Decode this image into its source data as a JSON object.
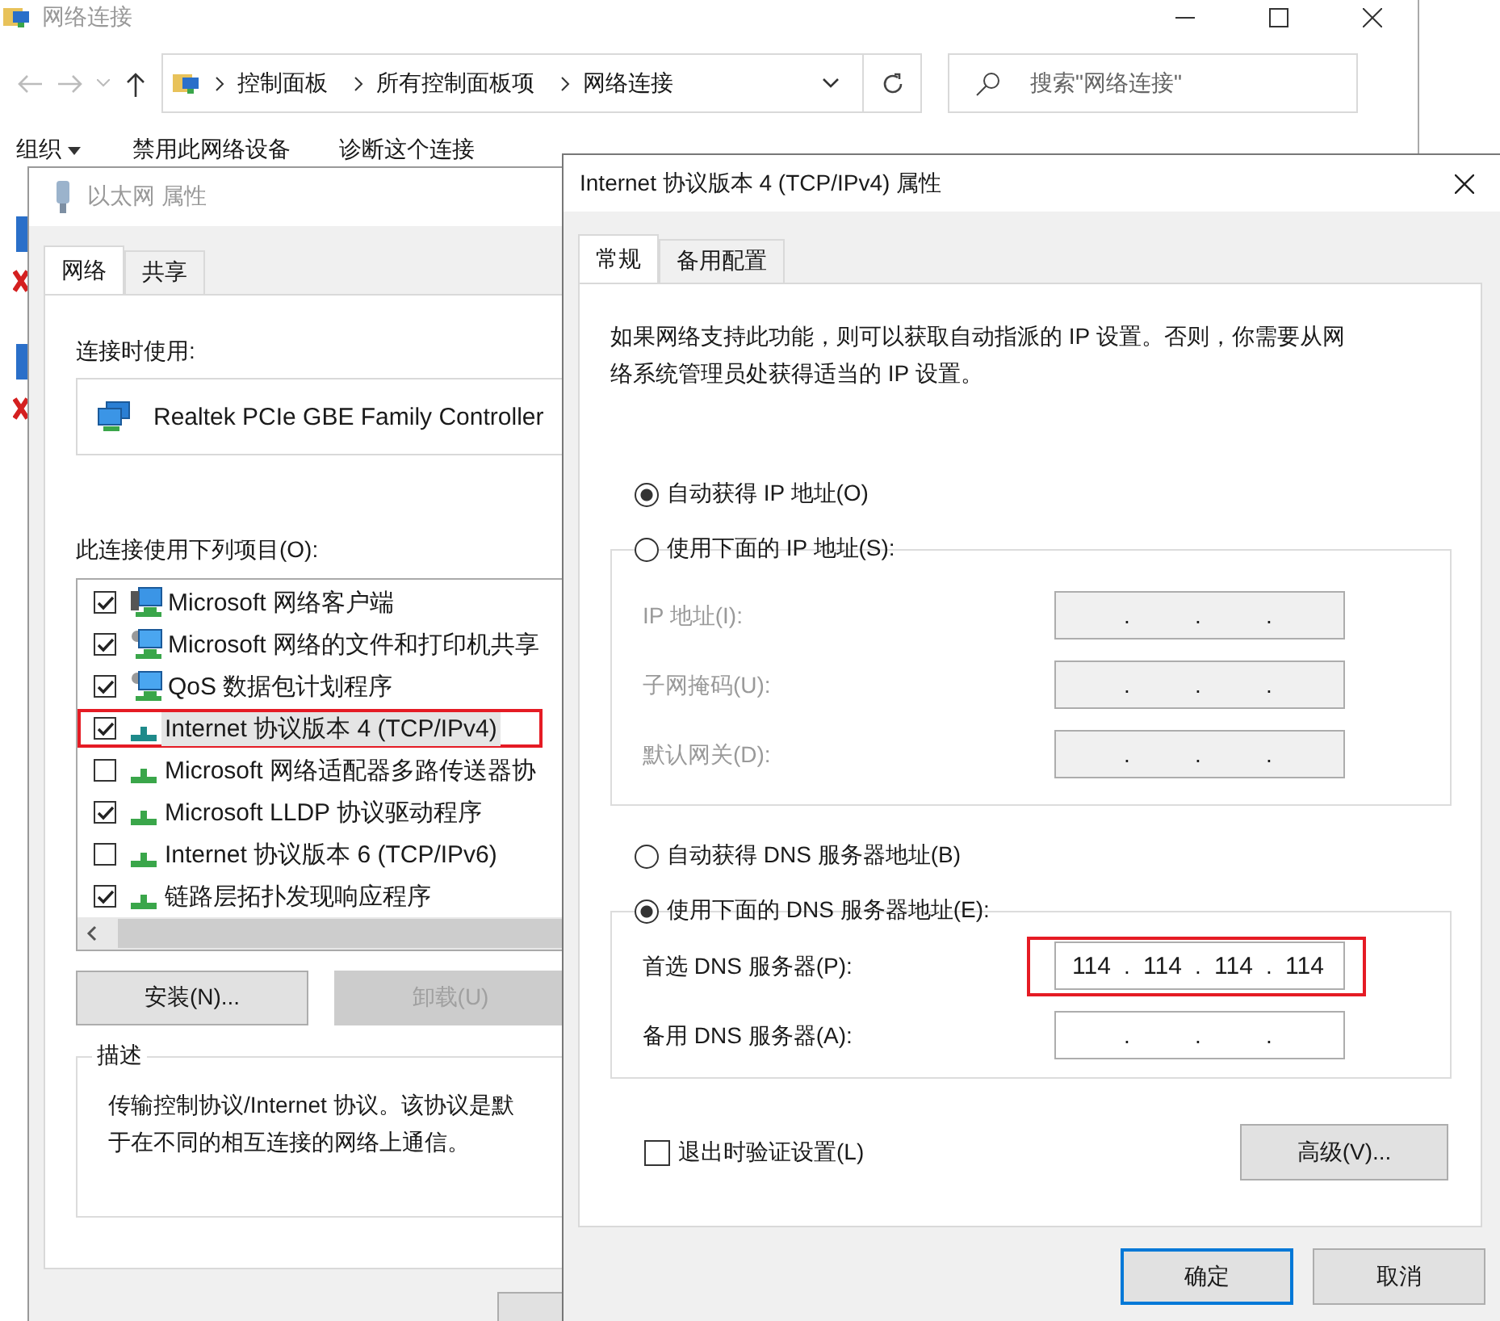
{
  "explorer": {
    "title": "网络连接",
    "breadcrumb": [
      "控制面板",
      "所有控制面板项",
      "网络连接"
    ],
    "search": {
      "placeholder": "搜索\"网络连接\""
    },
    "toolbar": [
      "组织",
      "禁用此网络设备",
      "诊断这个连接"
    ]
  },
  "ethernet_dialog": {
    "title": "以太网 属性",
    "tabs": [
      {
        "label": "网络",
        "selected": true
      },
      {
        "label": "共享",
        "selected": false
      }
    ],
    "connect_using_label": "连接时使用:",
    "adapter": "Realtek PCIe GBE Family Controller",
    "items_label": "此连接使用下列项目(O):",
    "items": [
      {
        "label": "Microsoft 网络客户端",
        "checked": true,
        "kind": "client",
        "selected": false,
        "annotated": false
      },
      {
        "label": "Microsoft 网络的文件和打印机共享",
        "checked": true,
        "kind": "service",
        "selected": false,
        "annotated": false
      },
      {
        "label": "QoS 数据包计划程序",
        "checked": true,
        "kind": "service",
        "selected": false,
        "annotated": false
      },
      {
        "label": "Internet 协议版本 4 (TCP/IPv4)",
        "checked": true,
        "kind": "protocol",
        "selected": true,
        "annotated": true
      },
      {
        "label": "Microsoft 网络适配器多路传送器协",
        "checked": false,
        "kind": "protocol",
        "selected": false,
        "annotated": false
      },
      {
        "label": "Microsoft LLDP 协议驱动程序",
        "checked": true,
        "kind": "protocol",
        "selected": false,
        "annotated": false
      },
      {
        "label": "Internet 协议版本 6 (TCP/IPv6)",
        "checked": false,
        "kind": "protocol",
        "selected": false,
        "annotated": false
      },
      {
        "label": "链路层拓扑发现响应程序",
        "checked": true,
        "kind": "protocol",
        "selected": false,
        "annotated": false
      }
    ],
    "buttons": [
      {
        "label": "安装(N)...",
        "disabled": false
      },
      {
        "label": "卸载(U)",
        "disabled": true
      }
    ],
    "description_label": "描述",
    "description_lines": [
      "传输控制协议/Internet 协议。该协议是默",
      "于在不同的相互连接的网络上通信。"
    ]
  },
  "ipv4_dialog": {
    "title": "Internet 协议版本 4 (TCP/IPv4) 属性",
    "tabs": [
      {
        "label": "常规",
        "selected": true
      },
      {
        "label": "备用配置",
        "selected": false
      }
    ],
    "intro": "如果网络支持此功能，则可以获取自动指派的 IP 设置。否则，你需要从网络系统管理员处获得适当的 IP 设置。",
    "ip_options": [
      {
        "label": "自动获得 IP 地址(O)",
        "selected": true
      },
      {
        "label": "使用下面的 IP 地址(S):",
        "selected": false
      }
    ],
    "ip_fields": [
      {
        "label": "IP 地址(I):",
        "disabled": true,
        "separators": [
          ".",
          ".",
          "."
        ],
        "annotated": false
      },
      {
        "label": "子网掩码(U):",
        "disabled": true,
        "separators": [
          ".",
          ".",
          "."
        ],
        "annotated": false
      },
      {
        "label": "默认网关(D):",
        "disabled": true,
        "separators": [
          ".",
          ".",
          "."
        ],
        "annotated": false
      }
    ],
    "dns_options": [
      {
        "label": "自动获得 DNS 服务器地址(B)",
        "selected": false
      },
      {
        "label": "使用下面的 DNS 服务器地址(E):",
        "selected": true
      }
    ],
    "dns_fields": [
      {
        "label": "首选 DNS 服务器(P):",
        "disabled": false,
        "separators": [
          ".",
          ".",
          "."
        ],
        "octets": [
          "114",
          "114",
          "114",
          "114"
        ],
        "annotated": true
      },
      {
        "label": "备用 DNS 服务器(A):",
        "disabled": false,
        "separators": [
          ".",
          ".",
          "."
        ],
        "annotated": false
      }
    ],
    "validate": {
      "label": "退出时验证设置(L)",
      "checked": false
    },
    "advanced_button": "高级(V)...",
    "buttons": [
      {
        "label": "确定",
        "default": true
      },
      {
        "label": "取消",
        "default": false
      }
    ]
  }
}
